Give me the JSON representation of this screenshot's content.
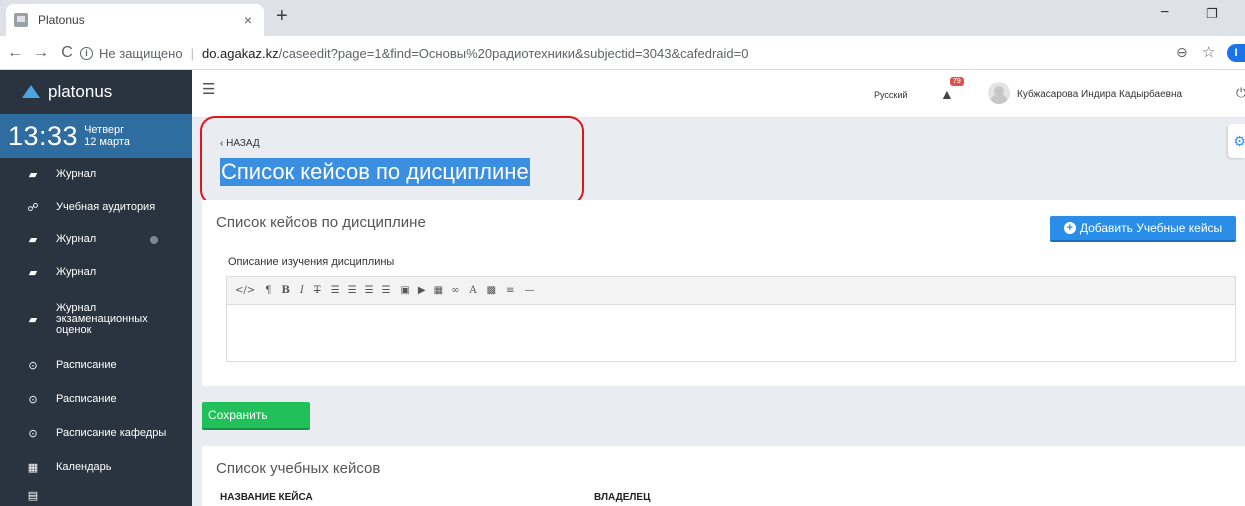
{
  "browser": {
    "tab_title": "Platonus",
    "tab_close": "×",
    "new_tab": "+",
    "minimize": "−",
    "restore": "❐",
    "back": "←",
    "forward": "→",
    "reload": "C",
    "not_secure": "Не защищено",
    "url_host": "do.agakaz.kz",
    "url_path": "/caseedit?page=1&find=Основы%20радиотехники&subjectid=3043&cafedraid=0",
    "profile_initial": "I"
  },
  "sidebar": {
    "brand": "platonus",
    "clock_time": "13:33",
    "clock_day": "Четверг",
    "clock_date": "12 марта",
    "items": [
      {
        "label": "Журнал",
        "icon": "book-icon"
      },
      {
        "label": "Учебная аудитория",
        "icon": "users-icon"
      },
      {
        "label": "Журнал",
        "icon": "book-icon"
      },
      {
        "label": "Журнал",
        "icon": "book-icon"
      },
      {
        "label": "Журнал экзаменационных оценок",
        "icon": "book-icon"
      },
      {
        "label": "Расписание",
        "icon": "clock-icon"
      },
      {
        "label": "Расписание",
        "icon": "clock-icon"
      },
      {
        "label": "Расписание кафедры",
        "icon": "clock-icon"
      },
      {
        "label": "Календарь",
        "icon": "calendar-icon"
      },
      {
        "label": "",
        "icon": "table-icon"
      }
    ]
  },
  "header": {
    "language": "Русский",
    "notifications_count": "79",
    "user_name": "Кубжасарова Индира Кадырбаевна"
  },
  "page": {
    "back_label": "НАЗАД",
    "title": "Список кейсов по дисциплине"
  },
  "cases_card": {
    "title": "Список кейсов по дисциплине",
    "add_button": "Добавить Учебные кейсы",
    "description_label": "Описание изучения дисциплины"
  },
  "save_label": "Сохранить",
  "list_card": {
    "title": "Список учебных кейсов",
    "col_name": "НАЗВАНИЕ КЕЙСА",
    "col_owner": "ВЛАДЕЛЕЦ"
  },
  "colors": {
    "sidebar": "#2a3441",
    "clock": "#2f6da1",
    "primary": "#2a8ee8",
    "success": "#22c05a",
    "highlight": "#e0141c"
  }
}
